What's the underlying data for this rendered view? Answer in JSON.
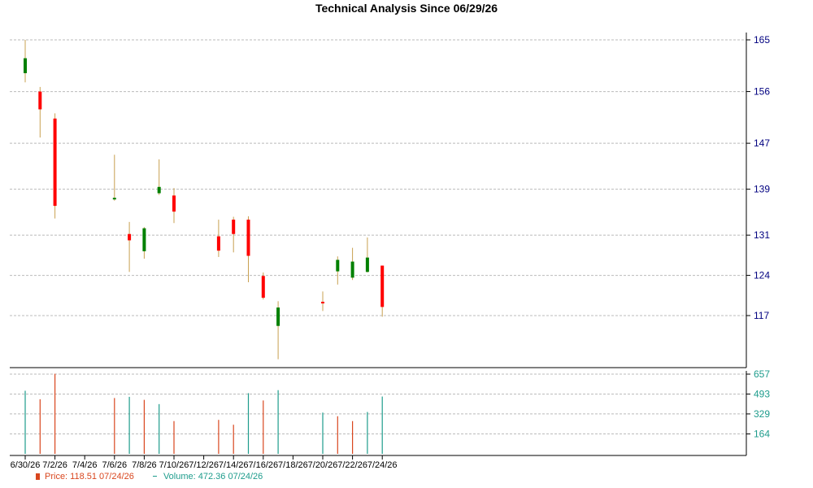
{
  "chart_data": [
    {
      "type": "candlestick",
      "title": "Technical Analysis Since 06/29/26",
      "x_tick_labels": [
        "6/30/26",
        "7/2/26",
        "7/4/26",
        "7/6/26",
        "7/8/26",
        "7/10/26",
        "7/12/26",
        "7/14/26",
        "7/16/26",
        "7/18/26",
        "7/20/26",
        "7/22/26",
        "7/24/26"
      ],
      "y_tick_labels": [
        165,
        156,
        147,
        139,
        131,
        124,
        117
      ],
      "ylim": [
        110,
        166.5
      ],
      "grid": true,
      "colors": {
        "up": "#008000",
        "down": "#ff0000",
        "wick": "#c8a050",
        "axis_text": "#000080"
      },
      "candles": [
        {
          "date": "6/30/26",
          "open": 159.2,
          "high": 165.0,
          "low": 157.6,
          "close": 161.8
        },
        {
          "date": "7/1/26",
          "open": 156.0,
          "high": 156.8,
          "low": 148.0,
          "close": 152.9
        },
        {
          "date": "7/2/26",
          "open": 151.3,
          "high": 152.2,
          "low": 133.9,
          "close": 136.1
        },
        {
          "date": "7/6/26",
          "open": 137.4,
          "high": 145.0,
          "low": 137.0,
          "close": 137.5
        },
        {
          "date": "7/7/26",
          "open": 131.2,
          "high": 133.3,
          "low": 124.6,
          "close": 130.1
        },
        {
          "date": "7/8/26",
          "open": 128.2,
          "high": 132.4,
          "low": 126.9,
          "close": 132.2
        },
        {
          "date": "7/9/26",
          "open": 138.3,
          "high": 144.2,
          "low": 138.0,
          "close": 139.4
        },
        {
          "date": "7/10/26",
          "open": 137.9,
          "high": 139.2,
          "low": 133.1,
          "close": 135.1
        },
        {
          "date": "7/13/26",
          "open": 130.8,
          "high": 133.7,
          "low": 127.2,
          "close": 128.3
        },
        {
          "date": "7/14/26",
          "open": 133.7,
          "high": 134.2,
          "low": 128.0,
          "close": 131.2
        },
        {
          "date": "7/15/26",
          "open": 133.7,
          "high": 134.3,
          "low": 122.8,
          "close": 127.4
        },
        {
          "date": "7/16/26",
          "open": 123.9,
          "high": 124.5,
          "low": 119.8,
          "close": 120.1
        },
        {
          "date": "7/17/26",
          "open": 115.2,
          "high": 119.5,
          "low": 109.4,
          "close": 118.4
        },
        {
          "date": "7/20/26",
          "open": 119.4,
          "high": 121.2,
          "low": 117.8,
          "close": 119.2
        },
        {
          "date": "7/21/26",
          "open": 124.7,
          "high": 127.3,
          "low": 122.4,
          "close": 126.7
        },
        {
          "date": "7/22/26",
          "open": 123.6,
          "high": 128.8,
          "low": 123.2,
          "close": 126.4
        },
        {
          "date": "7/23/26",
          "open": 124.6,
          "high": 130.6,
          "low": 124.5,
          "close": 127.1
        },
        {
          "date": "7/24/26",
          "open": 125.7,
          "high": 125.7,
          "low": 116.8,
          "close": 118.5
        }
      ]
    },
    {
      "type": "bar",
      "y_tick_labels": [
        657,
        493,
        329,
        164
      ],
      "ylim": [
        0,
        657
      ],
      "grid": true,
      "colors": {
        "up": "#1e9c8c",
        "down": "#d9461e",
        "axis_text": "#1e9c8c"
      },
      "bars": [
        {
          "date": "6/30/26",
          "value": 520,
          "dir": "up"
        },
        {
          "date": "7/1/26",
          "value": 450,
          "dir": "down"
        },
        {
          "date": "7/2/26",
          "value": 660,
          "dir": "down"
        },
        {
          "date": "7/6/26",
          "value": 460,
          "dir": "down"
        },
        {
          "date": "7/7/26",
          "value": 470,
          "dir": "up"
        },
        {
          "date": "7/8/26",
          "value": 445,
          "dir": "down"
        },
        {
          "date": "7/9/26",
          "value": 410,
          "dir": "up"
        },
        {
          "date": "7/10/26",
          "value": 270,
          "dir": "down"
        },
        {
          "date": "7/13/26",
          "value": 280,
          "dir": "down"
        },
        {
          "date": "7/14/26",
          "value": 240,
          "dir": "down"
        },
        {
          "date": "7/15/26",
          "value": 500,
          "dir": "up"
        },
        {
          "date": "7/16/26",
          "value": 440,
          "dir": "down"
        },
        {
          "date": "7/17/26",
          "value": 525,
          "dir": "up"
        },
        {
          "date": "7/20/26",
          "value": 340,
          "dir": "up"
        },
        {
          "date": "7/21/26",
          "value": 310,
          "dir": "down"
        },
        {
          "date": "7/22/26",
          "value": 270,
          "dir": "down"
        },
        {
          "date": "7/23/26",
          "value": 345,
          "dir": "up"
        },
        {
          "date": "7/24/26",
          "value": 472.36,
          "dir": "up"
        }
      ]
    }
  ],
  "legend": {
    "price_text": "Price: 118.51  07/24/26",
    "volume_text": "Volume: 472.36  07/24/26"
  }
}
